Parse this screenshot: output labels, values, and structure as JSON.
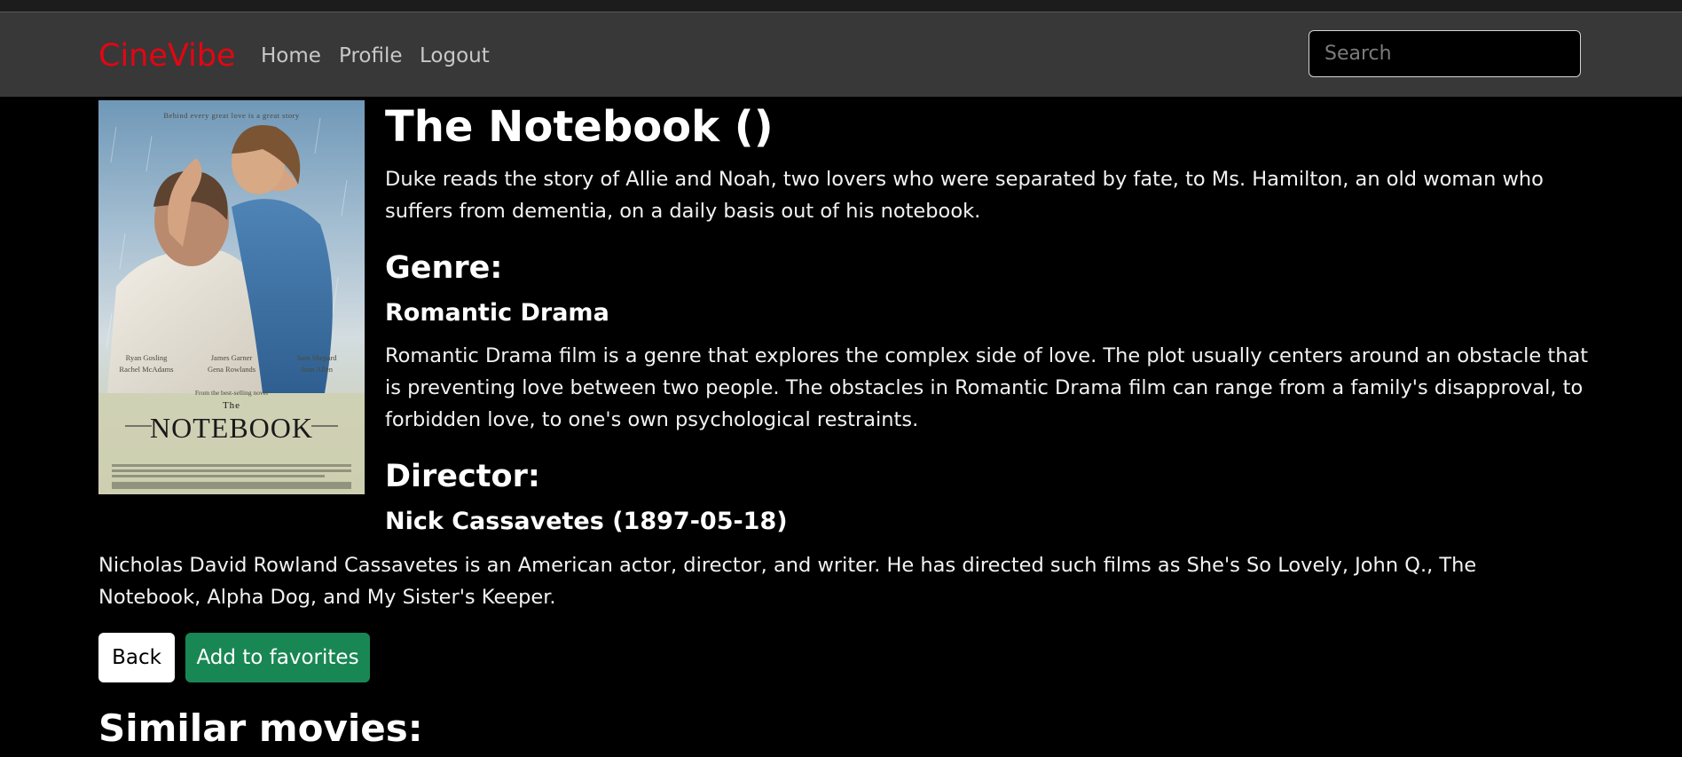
{
  "navbar": {
    "brand": "CineVibe",
    "links": [
      "Home",
      "Profile",
      "Logout"
    ],
    "search_placeholder": "Search"
  },
  "movie": {
    "title": "The Notebook ()",
    "description": "Duke reads the story of Allie and Noah, two lovers who were separated by fate, to Ms. Hamilton, an old woman who suffers from dementia, on a daily basis out of his notebook.",
    "poster": {
      "tagline": "Behind every great love is a great story",
      "cast": [
        "Ryan Gosling",
        "James Garner",
        "Sam Shepard",
        "Rachel McAdams",
        "Gena Rowlands",
        "Joan Allen"
      ],
      "from_novel": "From the best-selling novel",
      "logo_small": "The",
      "logo_big": "NOTEBOOK"
    }
  },
  "genre": {
    "heading": "Genre:",
    "name": "Romantic Drama",
    "description": "Romantic Drama film is a genre that explores the complex side of love. The plot usually centers around an obstacle that is preventing love between two people. The obstacles in Romantic Drama film can range from a family's disapproval, to forbidden love, to one's own psychological restraints."
  },
  "director": {
    "heading": "Director:",
    "name": "Nick Cassavetes (1897-05-18)",
    "bio": "Nicholas David Rowland Cassavetes is an American actor, director, and writer. He has directed such films as She's So Lovely, John Q., The Notebook, Alpha Dog, and My Sister's Keeper."
  },
  "buttons": {
    "back": "Back",
    "favorite": "Add to favorites"
  },
  "similar": {
    "heading": "Similar movies:"
  },
  "colors": {
    "brand": "#e30613",
    "navbar_bg": "#383838",
    "page_bg": "#000000",
    "favorite_button": "#198754"
  }
}
